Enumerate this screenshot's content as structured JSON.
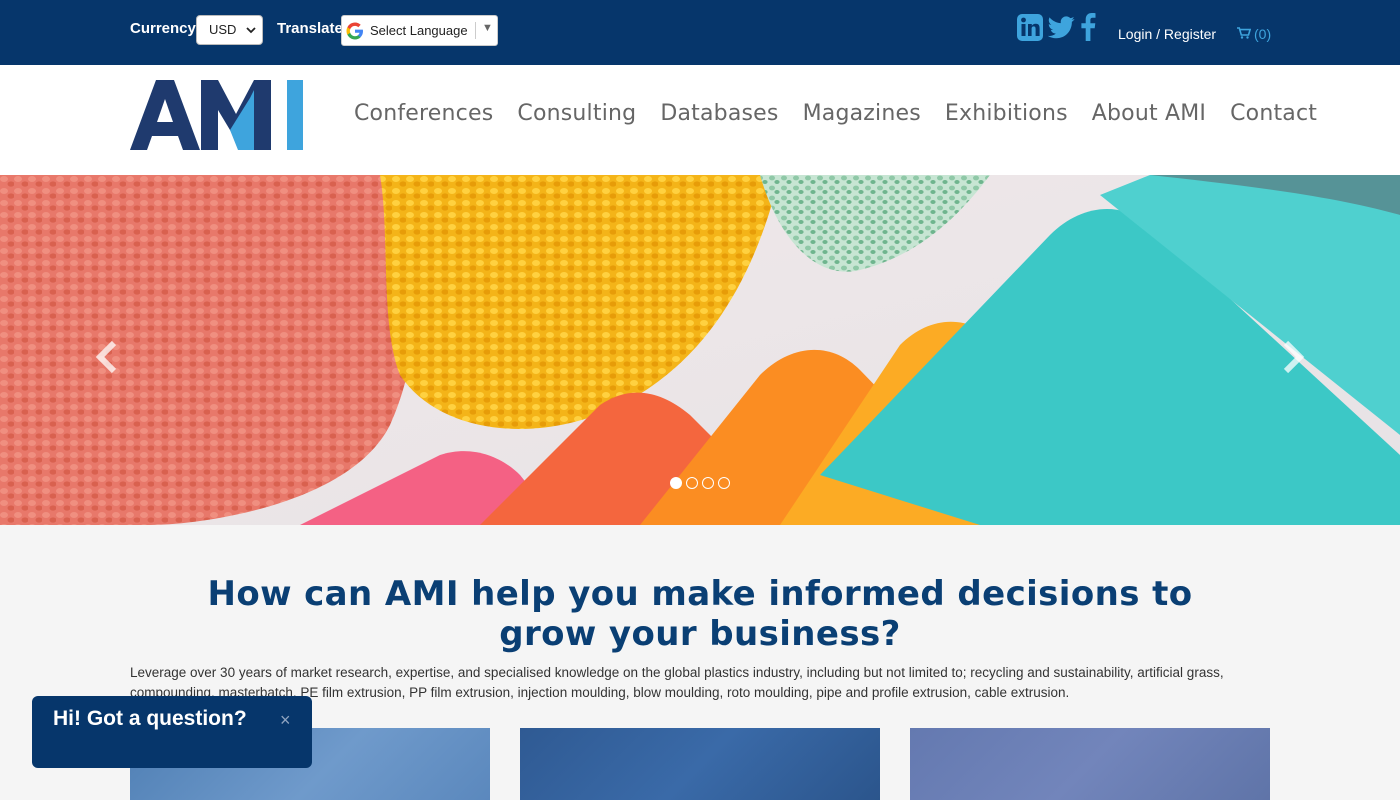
{
  "topbar": {
    "currency_label": "Currency:",
    "currency_value": "USD",
    "translate_label": "Translate:",
    "language_select": "Select Language",
    "social_icons": [
      "linkedin-icon",
      "twitter-icon",
      "facebook-icon"
    ],
    "login_label": "Login / Register",
    "cart_count": "(0)"
  },
  "header": {
    "logo_text": "AMI",
    "nav": [
      "Conferences",
      "Consulting",
      "Databases",
      "Magazines",
      "Exhibitions",
      "About AMI",
      "Contact"
    ]
  },
  "hero": {
    "slide_count": 4,
    "active_slide": 1
  },
  "intro": {
    "title": "How can AMI help you make informed decisions to grow your business?",
    "text": "Leverage over 30 years of market research, expertise, and specialised knowledge on the global plastics industry, including but not limited to; recycling and sustainability, artificial grass, compounding, masterbatch, PE film extrusion, PP film extrusion, injection moulding, blow moulding, roto moulding, pipe and profile extrusion, cable extrusion."
  },
  "chat": {
    "text": "Hi! Got a question?",
    "close": "×"
  },
  "colors": {
    "brand_navy": "#06366b",
    "accent_blue": "#3ea4dd",
    "title_blue": "#0a3f74"
  }
}
